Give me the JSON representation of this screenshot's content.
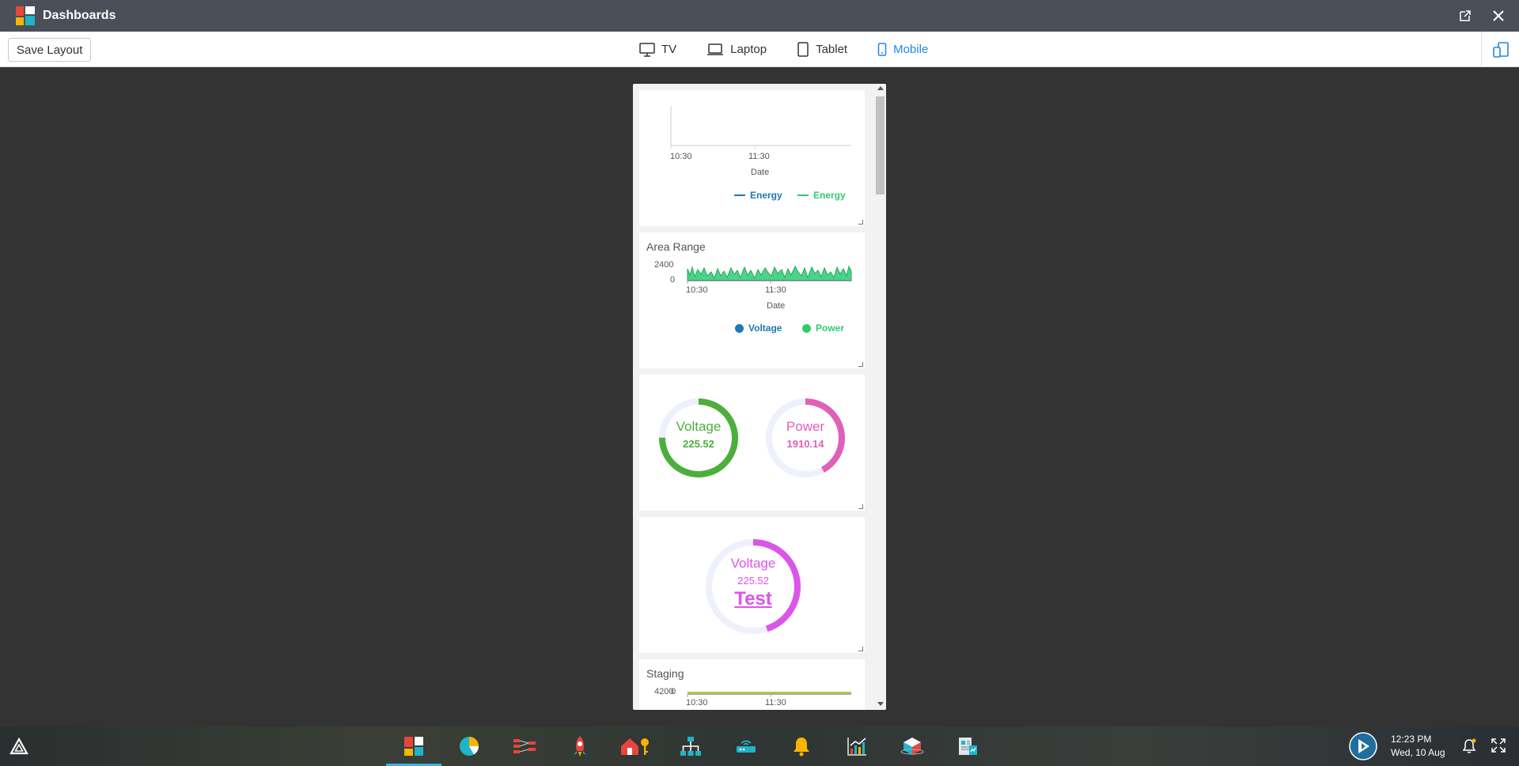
{
  "window": {
    "title": "Dashboards"
  },
  "toolbar": {
    "save_label": "Save Layout",
    "devices": [
      {
        "label": "TV",
        "icon": "tv-icon"
      },
      {
        "label": "Laptop",
        "icon": "laptop-icon"
      },
      {
        "label": "Tablet",
        "icon": "tablet-icon"
      },
      {
        "label": "Mobile",
        "icon": "mobile-icon",
        "active": true
      }
    ]
  },
  "widgets": {
    "energy_chart": {
      "x_ticks": [
        "10:30",
        "11:30"
      ],
      "xlabel": "Date",
      "legend": [
        {
          "name": "Energy",
          "color": "#1f77b4"
        },
        {
          "name": "Energy",
          "color": "#2ecc71"
        }
      ]
    },
    "area_range": {
      "title": "Area Range",
      "y_ticks": [
        "2400",
        "0"
      ],
      "x_ticks": [
        "10:30",
        "11:30"
      ],
      "xlabel": "Date",
      "legend": [
        {
          "name": "Voltage",
          "color": "#1f77b4"
        },
        {
          "name": "Power",
          "color": "#2ecc71"
        }
      ]
    },
    "gauges": [
      {
        "label": "Voltage",
        "value": "225.52",
        "color": "#4caf3c",
        "fraction": 0.75
      },
      {
        "label": "Power",
        "value": "1910.14",
        "color": "#e060b8",
        "fraction": 0.42
      }
    ],
    "test_gauge": {
      "label": "Voltage",
      "value": "225.52",
      "link": "Test",
      "color": "#dd55e8",
      "fraction": 0.45
    },
    "staging": {
      "title": "Staging",
      "y_ticks": [
        "4200",
        "0"
      ],
      "x_ticks": [
        "10:30",
        "11:30"
      ]
    }
  },
  "chart_data": [
    {
      "type": "area",
      "title": "Area Range",
      "xlabel": "Date",
      "ylabel": "",
      "x": [
        "10:30",
        "11:30"
      ],
      "ylim": [
        0,
        2400
      ],
      "series": [
        {
          "name": "Voltage",
          "color": "#1f77b4"
        },
        {
          "name": "Power",
          "color": "#2ecc71"
        }
      ]
    }
  ],
  "taskbar": {
    "apps": [
      "dashboards-app-icon",
      "reports-app-icon",
      "flows-app-icon",
      "rocket-app-icon",
      "home-key-app-icon",
      "hierarchy-app-icon",
      "router-app-icon",
      "alerts-app-icon",
      "analytics-app-icon",
      "cube-app-icon",
      "documents-app-icon"
    ],
    "time": "12:23 PM",
    "date": "Wed, 10 Aug"
  }
}
